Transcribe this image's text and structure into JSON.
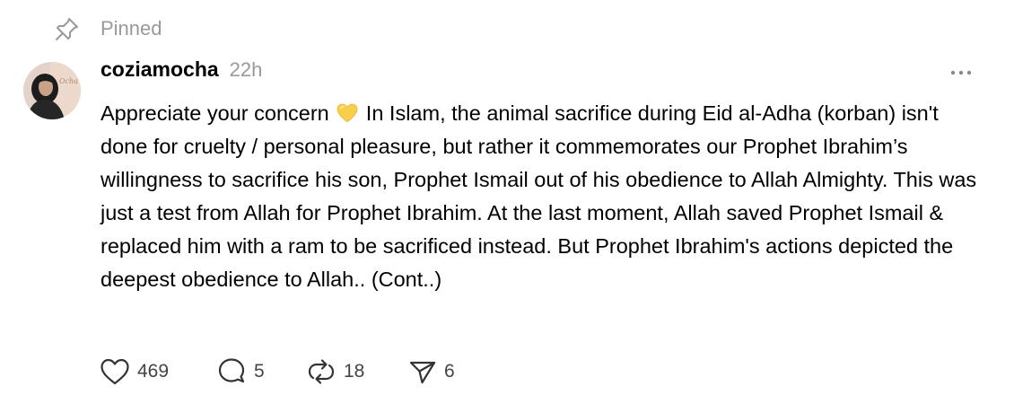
{
  "pinned": {
    "label": "Pinned",
    "icon": "pin-icon"
  },
  "author": {
    "username": "coziamocha",
    "timestamp": "22h",
    "avatar_text": "Ocha"
  },
  "post": {
    "text_before_emoji": "Appreciate your concern",
    "emoji": "yellow-heart",
    "text_after_emoji": "In Islam, the animal sacrifice during Eid al-Adha (korban) isn't done for cruelty / personal pleasure, but rather it commemorates our Prophet Ibrahim’s willingness to sacrifice his son, Prophet Ismail out of his obedience to Allah Almighty. This was just a test from Allah for Prophet Ibrahim. At the last moment, Allah saved Prophet Ismail & replaced him with a ram to be sacrificed instead. But Prophet Ibrahim's actions depicted the deepest obedience to Allah.. (Cont..)"
  },
  "actions": {
    "likes": "469",
    "replies": "5",
    "reposts": "18",
    "shares": "6"
  },
  "colors": {
    "muted_text": "#999999",
    "count_text": "#444444",
    "emoji_heart": "#F9CE4A"
  }
}
